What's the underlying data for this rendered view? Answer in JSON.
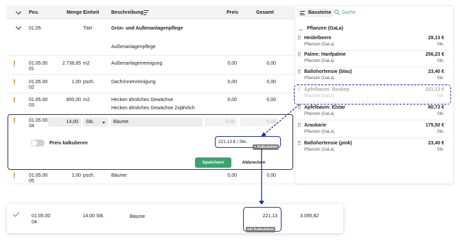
{
  "header": {
    "pos": "Pos.",
    "menge": "Menge",
    "einheit": "Einheit",
    "beschreibung": "Beschreibung",
    "preis": "Preis",
    "gesamt": "Gesamt"
  },
  "group": {
    "pos": "01.05.",
    "unit": "Titel",
    "title": "Grün- und Außenanlagenpflege",
    "subtitle": "Außenanlagenpflege"
  },
  "rows": [
    {
      "pos": "01.05.00",
      "pos2": "01",
      "menge": "2.736,65",
      "einheit": "m2",
      "beschreibung": "Außenanlagenreinigung",
      "preis": "0,00",
      "gesamt": "0,00"
    },
    {
      "pos": "01.05.00",
      "pos2": "02",
      "menge": "1,00",
      "einheit": "psch.",
      "beschreibung": "Dachrinnenreinigung",
      "preis": "0,00",
      "gesamt": "0,00"
    },
    {
      "pos": "01.05.00",
      "pos2": "03",
      "menge": "800,00",
      "einheit": "m2",
      "beschreibung": "Hecken ähnliches Gewächse",
      "beschreibung2": "Hecken ähnliches Gewächse 2xjährlich",
      "preis": "0,00",
      "gesamt": "0,00"
    },
    {
      "pos": "01.05.00",
      "pos2": "05",
      "menge": "1,00",
      "einheit": "psch.",
      "beschreibung": "Bäume",
      "preis": "0,00",
      "gesamt": "0,00"
    }
  ],
  "edit_row": {
    "pos": "01.05.00",
    "pos2": "04",
    "menge": "14,00",
    "einheit": "Stk.",
    "beschreibung": "Bäume",
    "preis_placeholder": "0,00",
    "gesamt_placeholder": "0,00",
    "toggle_label": "Preis kalkulieren",
    "toggle_on": false,
    "price_text": "221,13 € / Stk.",
    "kalk_badge": "+ Kalkulation",
    "save_label": "Speichern",
    "cancel_label": "Abbrechen"
  },
  "panel": {
    "tab_bausteine": "Bausteine",
    "tab_suche": "Suche",
    "breadcrumb": "Pflanzen (GaLa)",
    "items": [
      {
        "name": "Heidelbeere",
        "category": "Pflanzen (GaLa)",
        "price": "29,13 €",
        "unit": "Stk."
      },
      {
        "name": "Palme: Hanfpalme",
        "category": "Pflanzen (GaLa)",
        "price": "256,23 €",
        "unit": "Stk."
      },
      {
        "name": "Ballohortensie (blau)",
        "category": "Pflanzen (GaLa)",
        "price": "23,40 €",
        "unit": "Stk."
      },
      {
        "name": "Apfelbaum: Boskop",
        "category": "Pflanzen (GaLa)",
        "price": "221,13 €",
        "unit": "Stk."
      },
      {
        "name": "Apfelbaum: Elstar",
        "category": "Pflanzen (GaLa)",
        "price": "80,73 €",
        "unit": "Stk."
      },
      {
        "name": "Araukarie",
        "category": "Pflanzen (GaLa)",
        "price": "175,50 €",
        "unit": "Stk."
      },
      {
        "name": "Ballohortensie (pink)",
        "category": "Pflanzen (GaLa)",
        "price": "23,40 €",
        "unit": "Stk."
      }
    ]
  },
  "result_row": {
    "pos": "01.05.00",
    "pos2": "04",
    "menge": "14,00",
    "einheit": "Stk.",
    "beschreibung": "Bäume",
    "preis": "221,13",
    "badge": "mit Kalkulation",
    "gesamt": "3.095,82"
  },
  "colors": {
    "accent_green": "#3aa46e",
    "warning_orange": "#e07a0f",
    "highlight_navy": "#1c2ea8"
  }
}
